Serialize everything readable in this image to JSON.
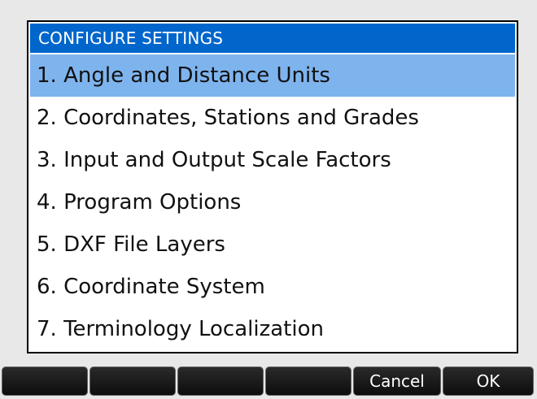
{
  "dialog": {
    "title": "CONFIGURE SETTINGS",
    "selected_index": 0,
    "items": [
      {
        "label": "1. Angle and Distance Units"
      },
      {
        "label": "2. Coordinates, Stations and Grades"
      },
      {
        "label": "3. Input and Output Scale Factors"
      },
      {
        "label": "4. Program Options"
      },
      {
        "label": "5. DXF File Layers"
      },
      {
        "label": "6. Coordinate System"
      },
      {
        "label": "7. Terminology Localization"
      }
    ]
  },
  "softkeys": [
    {
      "label": ""
    },
    {
      "label": ""
    },
    {
      "label": ""
    },
    {
      "label": ""
    },
    {
      "label": "Cancel"
    },
    {
      "label": "OK"
    }
  ],
  "colors": {
    "title_bar": "#0066cc",
    "selection": "#7eb4ee",
    "softkey_dark": "#1a1a1a",
    "softkey_light": "#d9d9d9"
  }
}
